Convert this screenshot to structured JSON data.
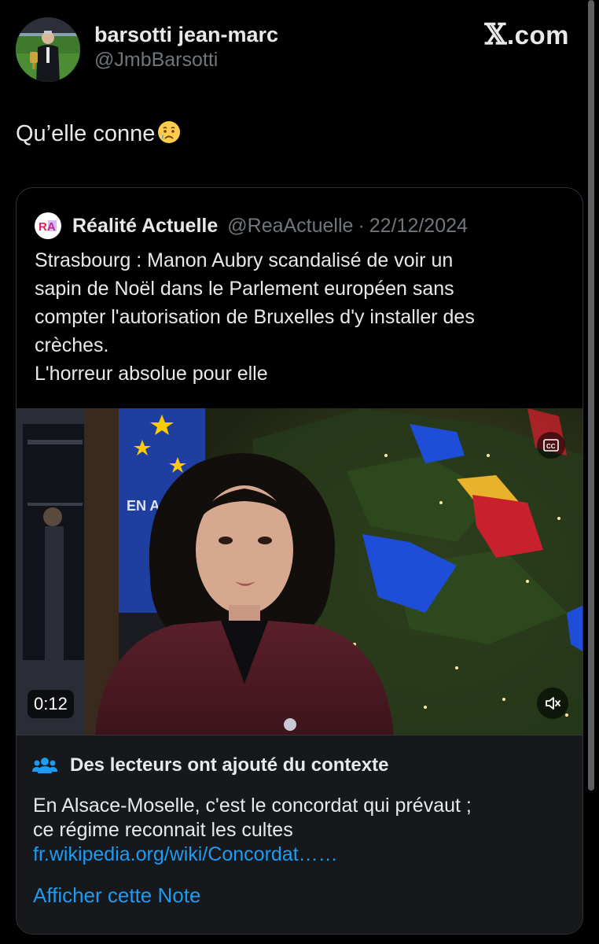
{
  "author": {
    "display_name": "barsotti jean-marc",
    "handle": "@JmbBarsotti"
  },
  "brand": {
    "x_glyph": "𝕏",
    "domain": ".com"
  },
  "tweet": {
    "text": "Qu’elle conne",
    "emoji_icon": "crying-face-icon"
  },
  "quoted_tweet": {
    "logo_text": "RA",
    "display_name": "Réalité Actuelle",
    "handle": "@ReaActuelle",
    "separator": "·",
    "date": "22/12/2024",
    "body_lines": [
      "Strasbourg : Manon Aubry scandalisé de voir un",
      "sapin de Noël dans le Parlement européen sans",
      "compter l'autorisation de Bruxelles d'y installer des",
      "crèches.",
      "L'horreur absolue pour elle"
    ],
    "video": {
      "duration": "0:12",
      "cc_label": "CC",
      "banner_text": "EN A"
    }
  },
  "community_note": {
    "title": "Des lecteurs ont ajouté du contexte",
    "body_lines": [
      "En Alsace-Moselle, c'est le concordat qui prévaut ;",
      "ce régime reconnait les cultes"
    ],
    "link": "fr.wikipedia.org/wiki/Concordat……",
    "cta": "Afficher cette Note"
  },
  "colors": {
    "background": "#000000",
    "text_primary": "#e7e9ea",
    "text_secondary": "#71767b",
    "link": "#1d9bf0",
    "card_border": "#2f3336",
    "note_background": "#16181c"
  }
}
